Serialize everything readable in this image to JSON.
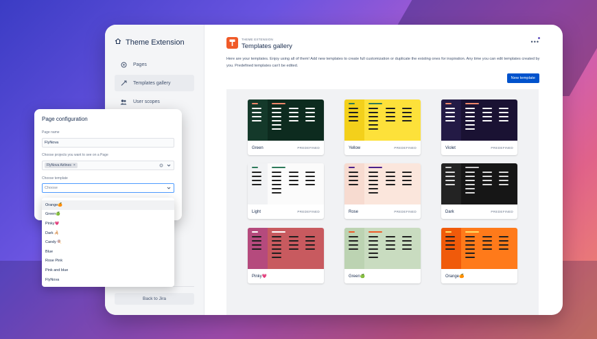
{
  "app": {
    "title": "Theme Extension",
    "back_label": "Back to Jira"
  },
  "sidebar": {
    "items": [
      {
        "label": "Pages",
        "icon": "pages-icon"
      },
      {
        "label": "Templates gallery",
        "icon": "templates-icon"
      },
      {
        "label": "User scopes",
        "icon": "users-icon"
      }
    ]
  },
  "header": {
    "kicker": "THEME EXTENSION",
    "title": "Templates gallery",
    "more": "•••",
    "description": "Here are your templates. Enjoy using all of them! Add new templates to create full customization or duplicate the existing ones for inspiration. Any time you can edit templates created by you. Predefined templates can't be edited.",
    "new_button": "New template"
  },
  "templates": [
    {
      "name": "Green",
      "badge": "PREDEFINED",
      "bg": "#0d2b1f",
      "side": "#14392a",
      "accent": "#f0876a",
      "line": "#ffffff"
    },
    {
      "name": "Yellow",
      "badge": "PREDEFINED",
      "bg": "#fde13a",
      "side": "#f3d01b",
      "accent": "#2d7a5a",
      "line": "#1e1e1e"
    },
    {
      "name": "Violet",
      "badge": "PREDEFINED",
      "bg": "#1a1233",
      "side": "#231a45",
      "accent": "#f0876a",
      "line": "#ffffff"
    },
    {
      "name": "Light",
      "badge": "PREDEFINED",
      "bg": "#fbfbfb",
      "side": "#f1f2f4",
      "accent": "#2d7a5a",
      "line": "#1e1e1e"
    },
    {
      "name": "Rose",
      "badge": "PREDEFINED",
      "bg": "#fbe6dc",
      "side": "#f7dbd0",
      "accent": "#4b1f8a",
      "line": "#1e1e1e"
    },
    {
      "name": "Dark",
      "badge": "PREDEFINED",
      "bg": "#161616",
      "side": "#232323",
      "accent": "#cccccc",
      "line": "#dddddd"
    },
    {
      "name": "Pinky💗",
      "badge": "",
      "bg": "#c85a5f",
      "side": "#b54a7d",
      "accent": "#ffffff",
      "line": "#1e1e1e"
    },
    {
      "name": "Green🍏",
      "badge": "",
      "bg": "#c9dcc0",
      "side": "#bcd3b2",
      "accent": "#f05a28",
      "line": "#1e1e1e"
    },
    {
      "name": "Orange🍊",
      "badge": "",
      "bg": "#ff7a1a",
      "side": "#f05a0a",
      "accent": "#ffe066",
      "line": "#1e1e1e"
    }
  ],
  "popup": {
    "title": "Page configuration",
    "name_label": "Page name",
    "name_value": "FlyNova",
    "projects_label": "Choose projects you want to see on a Page",
    "project_chip": "FlyNova Airlines",
    "chip_remove": "×",
    "template_label": "Choose template",
    "template_placeholder": "Choose",
    "options": [
      "Orange🍊",
      "Green🍏",
      "Pinky💗",
      "Dark 🦂",
      "Candy 🍭",
      "Blue",
      "Rose Pink",
      "Pink and blue",
      "FlyNova"
    ]
  },
  "colors": {
    "primary": "#0052cc",
    "logo": "#f05a28",
    "notify": "#6554c0"
  }
}
